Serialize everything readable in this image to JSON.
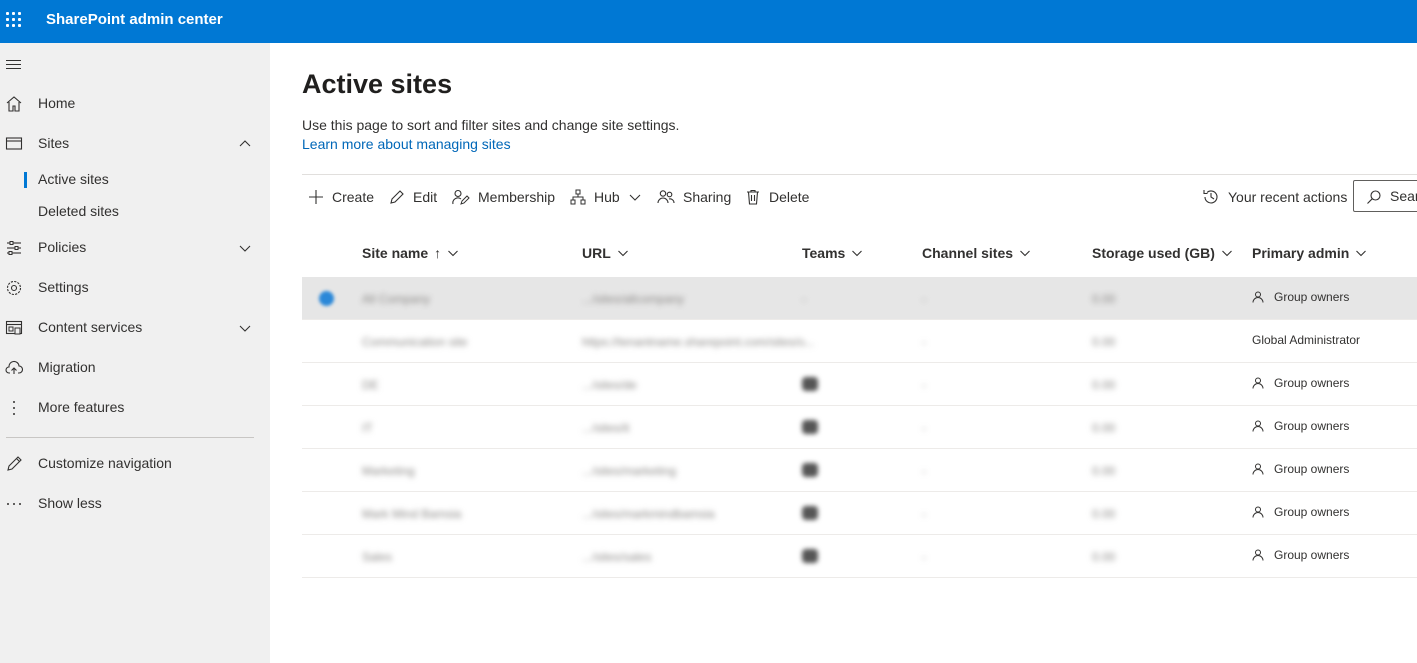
{
  "app": {
    "title": "SharePoint admin center"
  },
  "sidebar": {
    "items": [
      {
        "label": "Home"
      },
      {
        "label": "Sites"
      },
      {
        "label": "Active sites"
      },
      {
        "label": "Deleted sites"
      },
      {
        "label": "Policies"
      },
      {
        "label": "Settings"
      },
      {
        "label": "Content services"
      },
      {
        "label": "Migration"
      },
      {
        "label": "More features"
      },
      {
        "label": "Customize navigation"
      },
      {
        "label": "Show less"
      }
    ]
  },
  "main": {
    "title": "Active sites",
    "description": "Use this page to sort and filter sites and change site settings.",
    "learn_link": "Learn more about managing sites"
  },
  "toolbar": {
    "create": "Create",
    "edit": "Edit",
    "membership": "Membership",
    "hub": "Hub",
    "sharing": "Sharing",
    "delete": "Delete",
    "recent_actions": "Your recent actions",
    "search_label": "Sear"
  },
  "table": {
    "columns": [
      "Site name",
      "URL",
      "Teams",
      "Channel sites",
      "Storage used (GB)",
      "Primary admin"
    ],
    "sort_indicator": "↑",
    "rows": [
      {
        "site_name": "All Company",
        "url": ".../sites/allcompany",
        "teams": "-",
        "channel_sites": "-",
        "storage": "0.00",
        "primary_admin": "Group owners"
      },
      {
        "site_name": "Communication site",
        "url": "https://tenantname.sharepoint.com/sites/c...",
        "teams": "-",
        "channel_sites": "-",
        "storage": "0.00",
        "primary_admin": "Global Administrator"
      },
      {
        "site_name": "DE",
        "url": ".../sites/de",
        "teams": "",
        "channel_sites": "-",
        "storage": "0.00",
        "primary_admin": "Group owners"
      },
      {
        "site_name": "IT",
        "url": ".../sites/it",
        "teams": "",
        "channel_sites": "-",
        "storage": "0.00",
        "primary_admin": "Group owners"
      },
      {
        "site_name": "Marketing",
        "url": ".../sites/marketing",
        "teams": "",
        "channel_sites": "-",
        "storage": "0.00",
        "primary_admin": "Group owners"
      },
      {
        "site_name": "Mark Mind Bamsia",
        "url": ".../sites/markmindbamsia",
        "teams": "",
        "channel_sites": "-",
        "storage": "0.00",
        "primary_admin": "Group owners"
      },
      {
        "site_name": "Sales",
        "url": ".../sites/sales",
        "teams": "",
        "channel_sites": "-",
        "storage": "0.00",
        "primary_admin": "Group owners"
      }
    ]
  }
}
